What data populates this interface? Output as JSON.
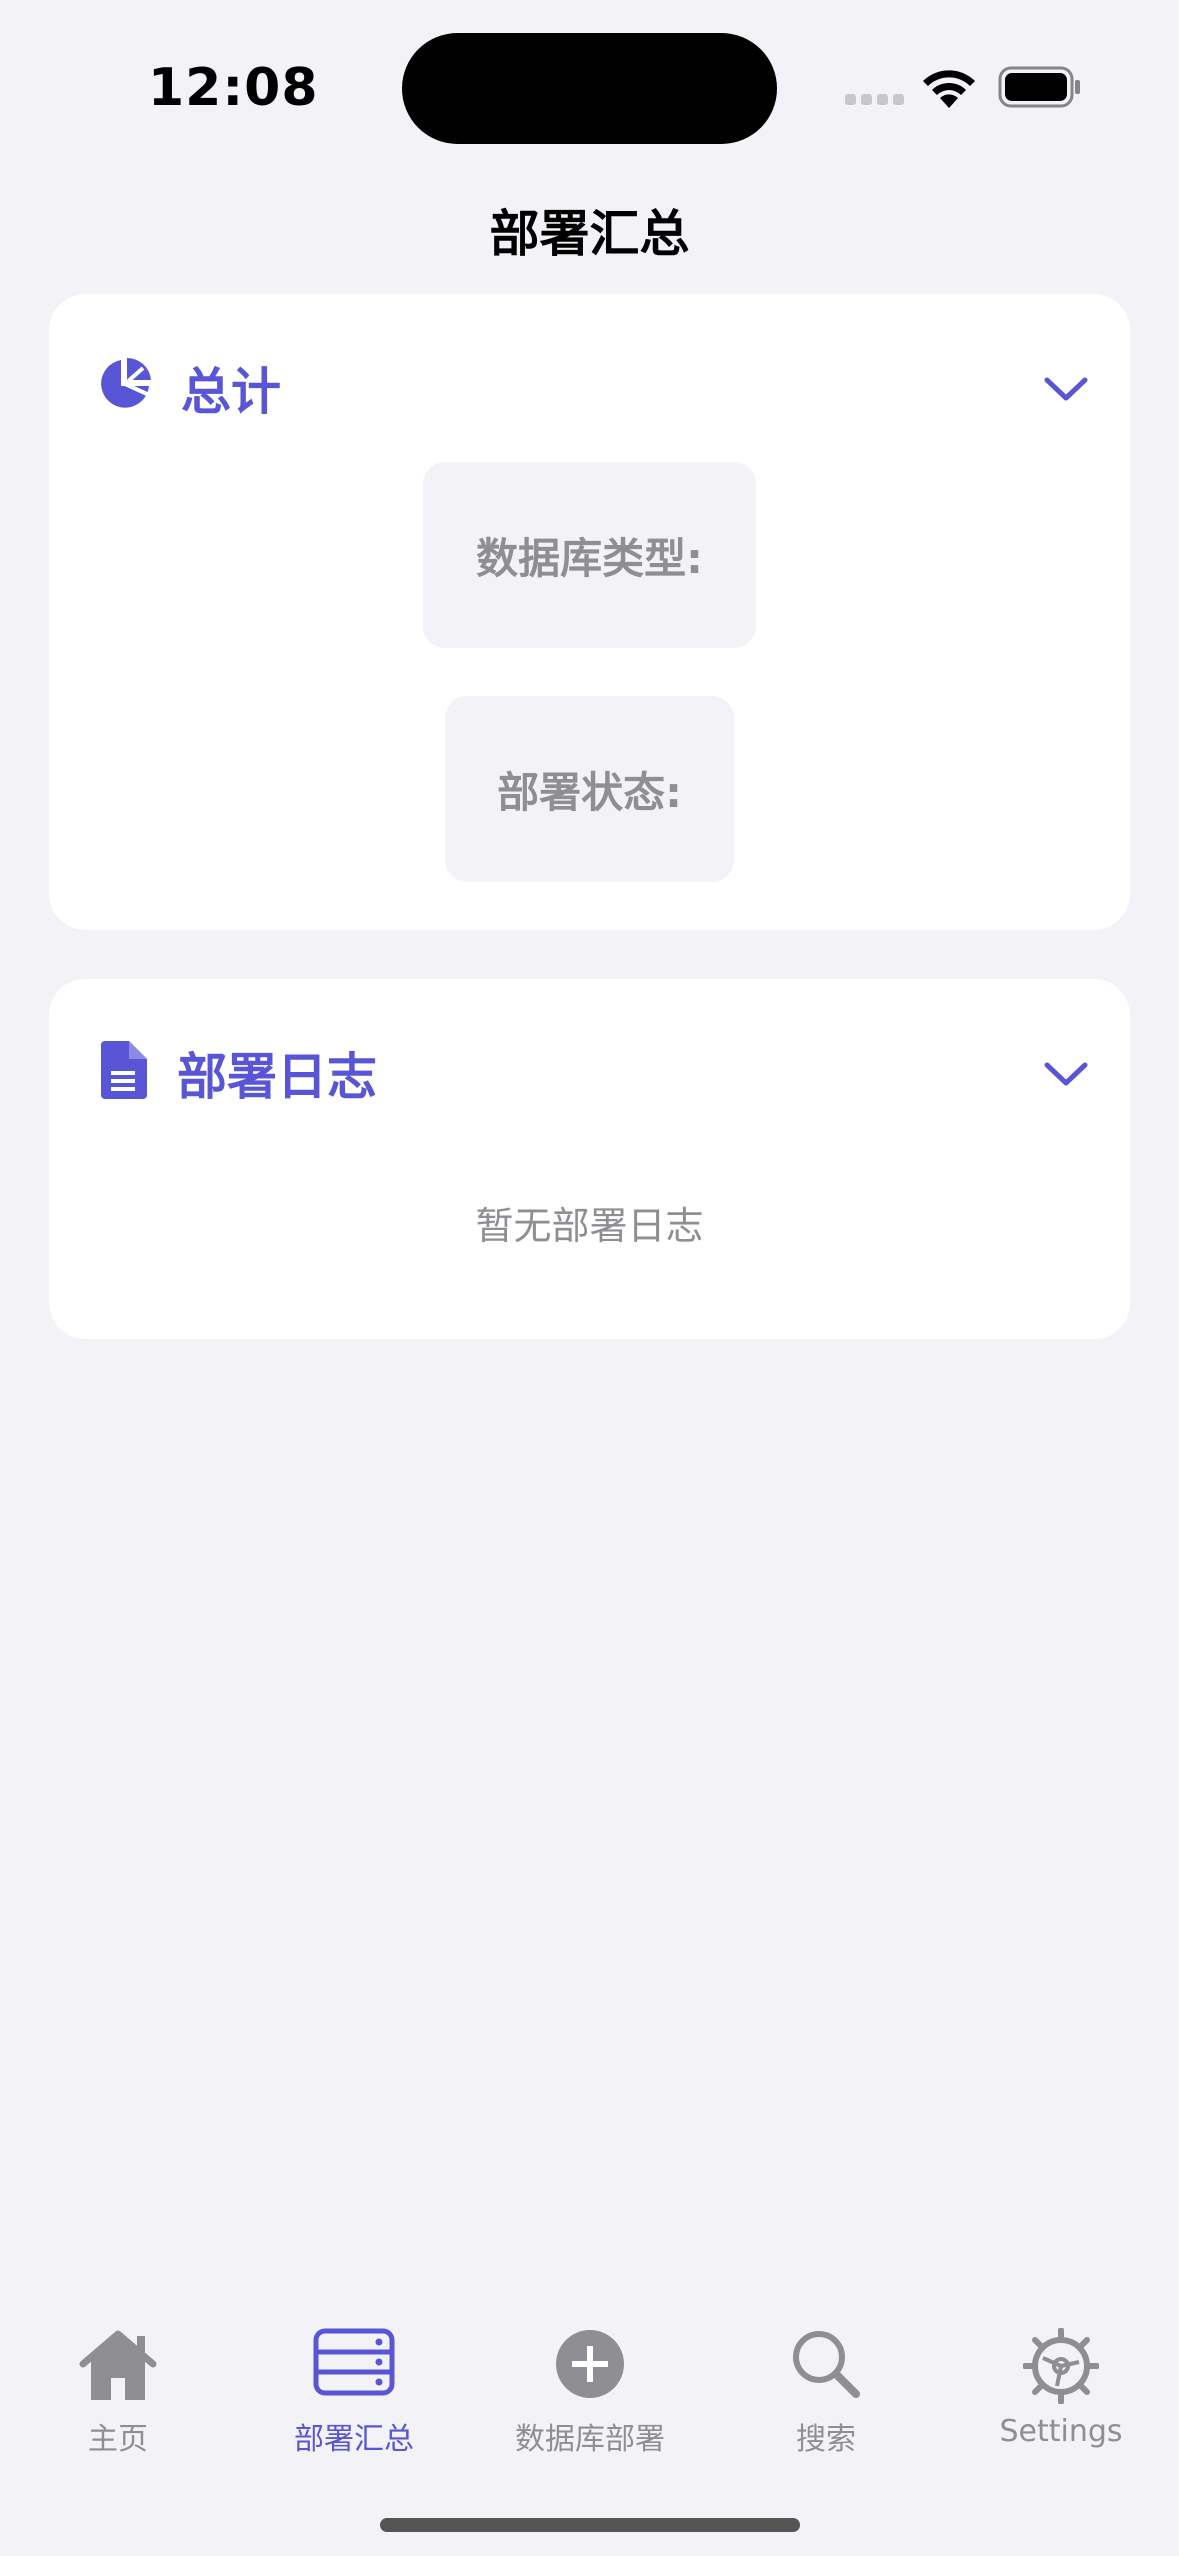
{
  "status_bar": {
    "time": "12:08"
  },
  "nav": {
    "title": "部署汇总"
  },
  "summary_card": {
    "title": "总计",
    "icon": "pie-chart-icon",
    "db_type_label": "数据库类型:",
    "status_label": "部署状态:"
  },
  "logs_card": {
    "title": "部署日志",
    "icon": "document-icon",
    "empty_text": "暂无部署日志"
  },
  "tab_bar": {
    "tabs": [
      {
        "label": "主页",
        "icon": "house-icon",
        "active": false
      },
      {
        "label": "部署汇总",
        "icon": "server-list-icon",
        "active": true
      },
      {
        "label": "数据库部署",
        "icon": "plus-circle-icon",
        "active": false
      },
      {
        "label": "搜索",
        "icon": "magnifier-icon",
        "active": false
      },
      {
        "label": "Settings",
        "icon": "gear-icon",
        "active": false
      }
    ]
  },
  "colors": {
    "accent": "#5856d6",
    "background": "#f2f2f7",
    "inactive": "#8e8e93"
  }
}
